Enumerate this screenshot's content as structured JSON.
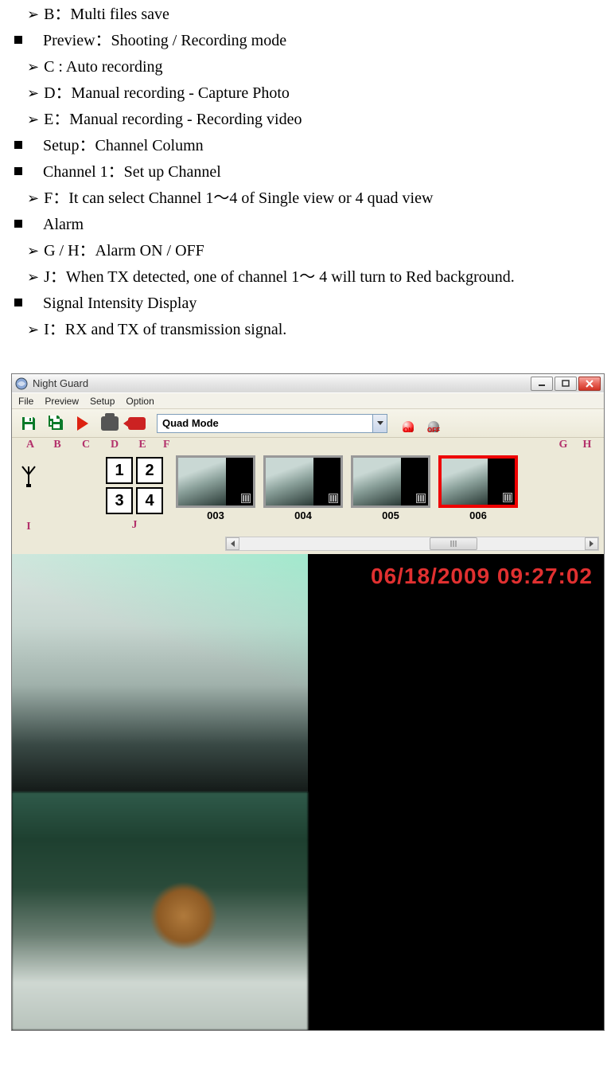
{
  "list": {
    "b": "B：Multi files save",
    "preview": "Preview：Shooting / Recording mode",
    "c": "C : Auto recording",
    "d": "D：Manual recording - Capture Photo",
    "e": "E：Manual recording - Recording video",
    "setup": "Setup：Channel Column",
    "ch1": "Channel 1：Set up Channel",
    "f": "F：It can select Channel 1～4 of Single view or 4 quad view",
    "alarmHead": "Alarm",
    "gh": "G / H：Alarm ON / OFF",
    "j": "J：When TX detected, one of channel 1～  4 will turn to Red background.",
    "sigHead": "Signal Intensity Display",
    "i": "I：RX and TX of transmission signal."
  },
  "app": {
    "title": "Night Guard",
    "menu": {
      "file": "File",
      "preview": "Preview",
      "setup": "Setup",
      "option": "Option"
    },
    "dropdown": "Quad Mode",
    "alarm_on": "ON",
    "alarm_off": "OFF",
    "letters": {
      "a": "A",
      "b": "B",
      "c": "C",
      "d": "D",
      "e": "E",
      "f": "F",
      "g": "G",
      "h": "H",
      "i": "I",
      "j": "J"
    },
    "quad": {
      "q1": "1",
      "q2": "2",
      "q3": "3",
      "q4": "4"
    },
    "thumbs": [
      "003",
      "004",
      "005",
      "006"
    ],
    "timestamp": "06/18/2009  09:27:02"
  }
}
